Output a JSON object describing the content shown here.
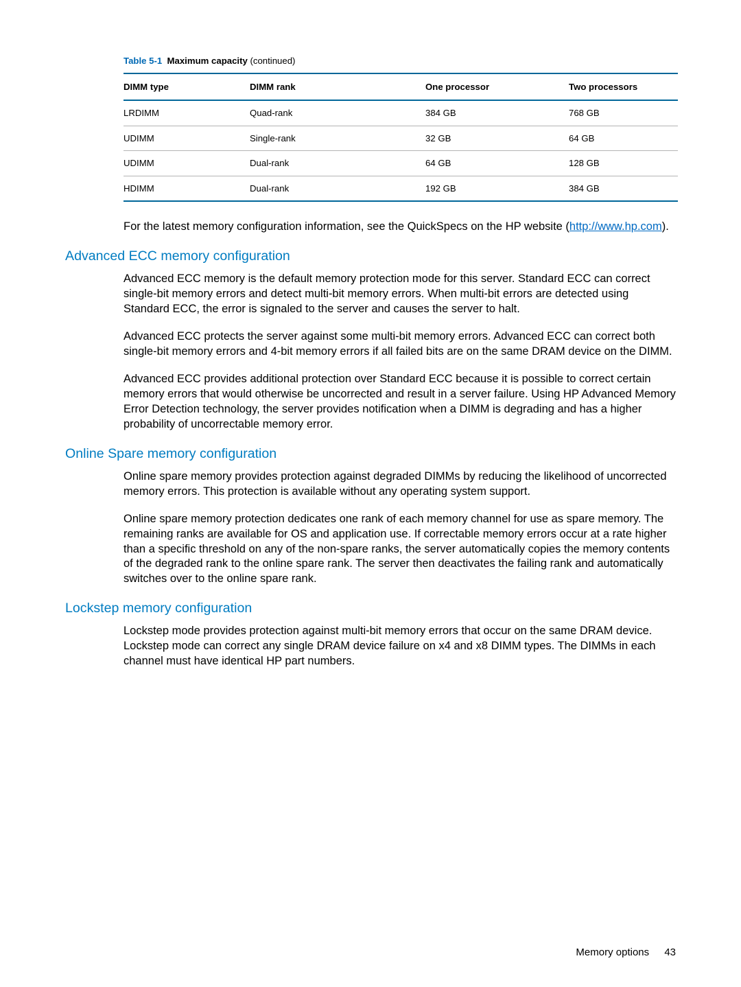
{
  "table": {
    "caption_id": "Table 5-1",
    "caption_title": "Maximum capacity",
    "caption_suffix": " (continued)",
    "headers": {
      "c0": "DIMM type",
      "c1": "DIMM rank",
      "c2": "One processor",
      "c3": "Two processors"
    },
    "rows": [
      {
        "c0": "LRDIMM",
        "c1": "Quad-rank",
        "c2": "384 GB",
        "c3": "768 GB"
      },
      {
        "c0": "UDIMM",
        "c1": "Single-rank",
        "c2": "32 GB",
        "c3": "64 GB"
      },
      {
        "c0": "UDIMM",
        "c1": "Dual-rank",
        "c2": "64 GB",
        "c3": "128 GB"
      },
      {
        "c0": "HDIMM",
        "c1": "Dual-rank",
        "c2": "192 GB",
        "c3": "384 GB"
      }
    ]
  },
  "intro": {
    "lead": "For the latest memory configuration information, see the QuickSpecs on the HP website (",
    "link": "http://www.hp.com",
    "tail": ")."
  },
  "sections": {
    "advanced": {
      "heading": "Advanced ECC memory configuration",
      "p1": "Advanced ECC memory is the default memory protection mode for this server. Standard ECC can correct single-bit memory errors and detect multi-bit memory errors. When multi-bit errors are detected using Standard ECC, the error is signaled to the server and causes the server to halt.",
      "p2": "Advanced ECC protects the server against some multi-bit memory errors. Advanced ECC can correct both single-bit memory errors and 4-bit memory errors if all failed bits are on the same DRAM device on the DIMM.",
      "p3": "Advanced ECC provides additional protection over Standard ECC because it is possible to correct certain memory errors that would otherwise be uncorrected and result in a server failure. Using HP Advanced Memory Error Detection technology, the server provides notification when a DIMM is degrading and has a higher probability of uncorrectable memory error."
    },
    "online": {
      "heading": "Online Spare memory configuration",
      "p1": "Online spare memory provides protection against degraded DIMMs by reducing the likelihood of uncorrected memory errors. This protection is available without any operating system support.",
      "p2": "Online spare memory protection dedicates one rank of each memory channel for use as spare memory. The remaining ranks are available for OS and application use. If correctable memory errors occur at a rate higher than a specific threshold on any of the non-spare ranks, the server automatically copies the memory contents of the degraded rank to the online spare rank. The server then deactivates the failing rank and automatically switches over to the online spare rank."
    },
    "lockstep": {
      "heading": "Lockstep memory configuration",
      "p1": "Lockstep mode provides protection against multi-bit memory errors that occur on the same DRAM device. Lockstep mode can correct any single DRAM device failure on x4 and x8 DIMM types. The DIMMs in each channel must have identical HP part numbers."
    }
  },
  "footer": {
    "section": "Memory options",
    "page": "43"
  }
}
